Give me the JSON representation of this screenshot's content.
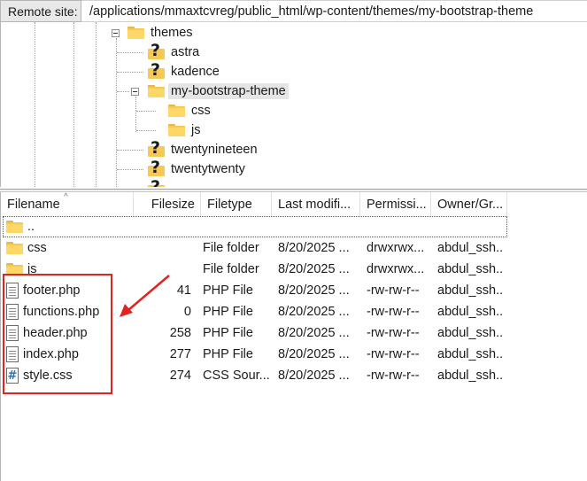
{
  "remote_site": {
    "label": "Remote site:",
    "path": "/applications/mmaxtcvreg/public_html/wp-content/themes/my-bootstrap-theme"
  },
  "tree": {
    "themes": "themes",
    "astra": "astra",
    "kadence": "kadence",
    "my_bootstrap_theme": "my-bootstrap-theme",
    "css": "css",
    "js": "js",
    "twentynineteen": "twentynineteen",
    "twentytwenty": "twentytwenty"
  },
  "file_list": {
    "columns": [
      "Filename",
      "Filesize",
      "Filetype",
      "Last modifi...",
      "Permissi...",
      "Owner/Gr..."
    ],
    "updir": "..",
    "rows": [
      {
        "name": "css",
        "size": "",
        "type": "File folder",
        "modified": "8/20/2025 ...",
        "perms": "drwxrwx...",
        "owner": "abdul_ssh...",
        "icon": "folder-icon"
      },
      {
        "name": "js",
        "size": "",
        "type": "File folder",
        "modified": "8/20/2025 ...",
        "perms": "drwxrwx...",
        "owner": "abdul_ssh...",
        "icon": "folder-icon"
      },
      {
        "name": "footer.php",
        "size": "41",
        "type": "PHP File",
        "modified": "8/20/2025 ...",
        "perms": "-rw-rw-r--",
        "owner": "abdul_ssh...",
        "icon": "file-icon"
      },
      {
        "name": "functions.php",
        "size": "0",
        "type": "PHP File",
        "modified": "8/20/2025 ...",
        "perms": "-rw-rw-r--",
        "owner": "abdul_ssh...",
        "icon": "file-icon"
      },
      {
        "name": "header.php",
        "size": "258",
        "type": "PHP File",
        "modified": "8/20/2025 ...",
        "perms": "-rw-rw-r--",
        "owner": "abdul_ssh...",
        "icon": "file-icon"
      },
      {
        "name": "index.php",
        "size": "277",
        "type": "PHP File",
        "modified": "8/20/2025 ...",
        "perms": "-rw-rw-r--",
        "owner": "abdul_ssh...",
        "icon": "file-icon"
      },
      {
        "name": "style.css",
        "size": "274",
        "type": "CSS Sour...",
        "modified": "8/20/2025 ...",
        "perms": "-rw-rw-r--",
        "owner": "abdul_ssh...",
        "icon": "css-file-icon"
      }
    ]
  },
  "colors": {
    "annotation": "#e32222",
    "folder": "#f7c954"
  }
}
